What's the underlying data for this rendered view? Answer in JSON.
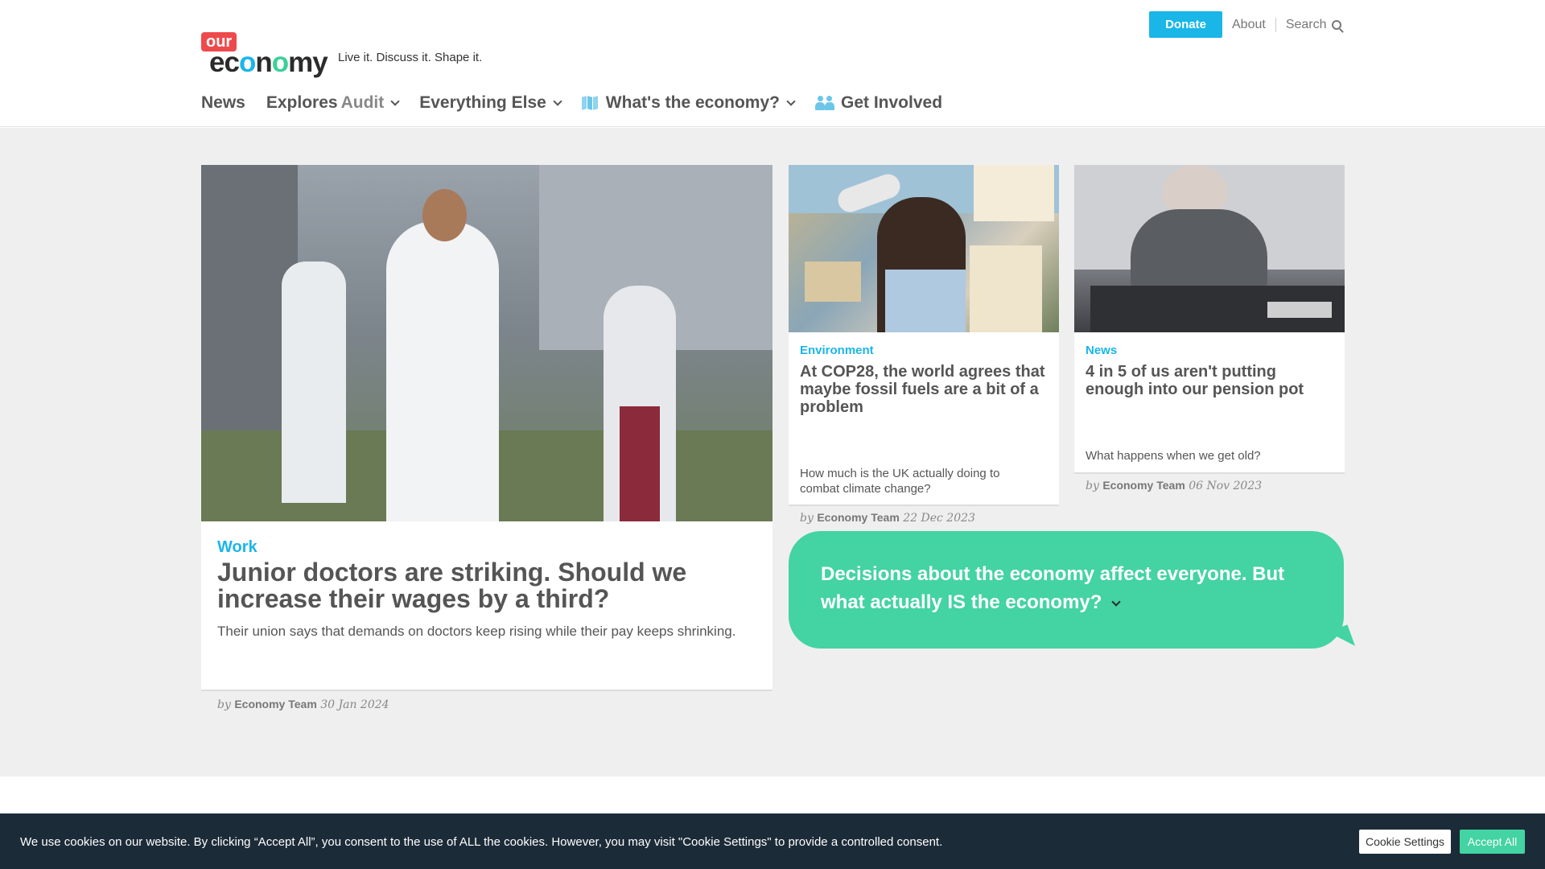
{
  "header": {
    "donate_label": "Donate",
    "about_label": "About",
    "search_label": "Search",
    "logo": {
      "our": "our",
      "econ_a": "ec",
      "econ_o1": "o",
      "econ_b": "n",
      "econ_o2": "o",
      "econ_c": "my"
    },
    "tagline": "Live it. Discuss it. Shape it."
  },
  "nav": {
    "news": "News",
    "explores": "Explores",
    "audit": "Audit",
    "everything_else": "Everything Else",
    "whats_economy": "What's the economy?",
    "get_involved": "Get Involved"
  },
  "articles": {
    "main": {
      "category": "Work",
      "title": "Junior doctors are striking. Should we increase their wages by a third?",
      "excerpt": "Their union says that demands on doctors keep rising while their pay keeps shrinking.",
      "by": "by",
      "author": "Economy Team",
      "date": "30 Jan 2024"
    },
    "env": {
      "category": "Environment",
      "title": "At COP28, the world agrees that maybe fossil fuels are a bit of a problem",
      "excerpt": "How much is the UK actually doing to combat climate change?",
      "by": "by",
      "author": "Economy Team",
      "date": "22 Dec 2023"
    },
    "pension": {
      "category": "News",
      "title": "4 in 5 of us aren't putting enough into our pension pot",
      "excerpt": "What happens when we get old?",
      "by": "by",
      "author": "Economy Team",
      "date": "06 Nov 2023"
    }
  },
  "bubble": {
    "text": "Decisions about the economy affect everyone. But what actually IS the economy?"
  },
  "cookie": {
    "text": "We use cookies on our website. By clicking “Accept All”, you consent to the use of ALL the cookies. However, you may visit \"Cookie Settings\" to provide a controlled consent.",
    "settings_label": "Cookie Settings",
    "accept_label": "Accept All"
  },
  "colors": {
    "accent_blue": "#1ab6e8",
    "accent_green": "#44d3a3",
    "logo_red": "#ee4a4c",
    "cookie_bg": "#1c2b38"
  }
}
